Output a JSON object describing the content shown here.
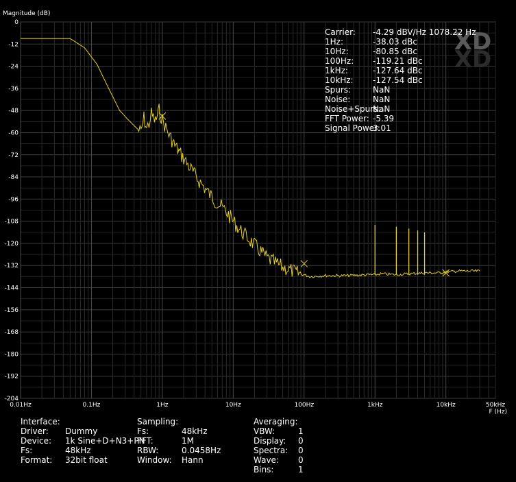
{
  "chart_data": {
    "type": "line",
    "ylabel": "Magnitude (dB)",
    "xlabel": "F (Hz)",
    "xscale": "log",
    "xlim": [
      0.01,
      50000
    ],
    "ylim": [
      -204,
      0
    ],
    "grid": true,
    "line_color": "#e6d21e",
    "xticks": [
      {
        "value": 0.01,
        "label": "0.01Hz"
      },
      {
        "value": 0.1,
        "label": "0.1Hz"
      },
      {
        "value": 1,
        "label": "1Hz"
      },
      {
        "value": 10,
        "label": "10Hz"
      },
      {
        "value": 100,
        "label": "100Hz"
      },
      {
        "value": 1000,
        "label": "1kHz"
      },
      {
        "value": 10000,
        "label": "10kHz"
      },
      {
        "value": 50000,
        "label": "50kHz"
      }
    ],
    "yticks": [
      0,
      -12,
      -24,
      -36,
      -48,
      -60,
      -72,
      -84,
      -96,
      -108,
      -120,
      -132,
      -144,
      -156,
      -168,
      -180,
      -192,
      -204
    ],
    "x": [
      0.01,
      0.05,
      0.08,
      0.12,
      0.18,
      0.25,
      0.33,
      0.42,
      0.5,
      0.55,
      0.6,
      0.65,
      0.7,
      0.8,
      0.9,
      1.0,
      1.2,
      1.5,
      2,
      3,
      5,
      8,
      12,
      20,
      30,
      50,
      80,
      120,
      200,
      400,
      800,
      1000,
      1200,
      2000,
      3000,
      5000,
      8000,
      10000,
      15000,
      20000,
      30000
    ],
    "y": [
      -9,
      -9,
      -14,
      -23,
      -37,
      -48,
      -53,
      -57,
      -60,
      -52,
      -58,
      -55,
      -50,
      -54,
      -48,
      -53,
      -60,
      -67,
      -74,
      -84,
      -95,
      -103,
      -112,
      -121,
      -128,
      -133,
      -136,
      -138,
      -137.5,
      -137.5,
      -137,
      -137,
      -136.5,
      -137,
      -136.5,
      -136,
      -136,
      -135.5,
      -135,
      -135,
      -135
    ],
    "spurs": [
      {
        "x": 1000,
        "y": -110
      },
      {
        "x": 2000,
        "y": -111
      },
      {
        "x": 3000,
        "y": -112
      },
      {
        "x": 4000,
        "y": -113
      },
      {
        "x": 5000,
        "y": -114
      }
    ],
    "markers": [
      {
        "x": 1,
        "y": -51
      },
      {
        "x": 100,
        "y": -131
      },
      {
        "x": 10000,
        "y": -136
      }
    ]
  },
  "readout": [
    {
      "label": "Carrier:",
      "value": "-4.29 dBV/Hz 1078.22 Hz"
    },
    {
      "label": "1Hz:",
      "value": "-38.03 dBc"
    },
    {
      "label": "10Hz:",
      "value": "-80.85 dBc"
    },
    {
      "label": "100Hz:",
      "value": "-119.21 dBc"
    },
    {
      "label": "1kHz:",
      "value": "-127.64 dBc"
    },
    {
      "label": "10kHz:",
      "value": "-127.54 dBc"
    },
    {
      "label": "Spurs:",
      "value": "NaN"
    },
    {
      "label": "Noise:",
      "value": "NaN"
    },
    {
      "label": "Noise+Spurs:",
      "value": "NaN"
    },
    {
      "label": "FFT Power:",
      "value": "-5.39"
    },
    {
      "label": "Signal Power:",
      "value": "3.01"
    }
  ],
  "logo": "XD",
  "interface": {
    "heading": "Interface:",
    "rows": [
      {
        "label": "Driver:",
        "value": "Dummy"
      },
      {
        "label": "Device:",
        "value": "1k Sine+D+N3+PN"
      },
      {
        "label": "Fs:",
        "value": "48kHz"
      },
      {
        "label": "Format:",
        "value": "32bit float"
      }
    ]
  },
  "sampling": {
    "heading": "Sampling:",
    "rows": [
      {
        "label": "Fs:",
        "value": "48kHz"
      },
      {
        "label": "FFT:",
        "value": "1M"
      },
      {
        "label": "RBW:",
        "value": "0.0458Hz"
      },
      {
        "label": "Window:",
        "value": "Hann"
      }
    ]
  },
  "averaging": {
    "heading": "Averaging:",
    "rows": [
      {
        "label": "VBW:",
        "value": "1"
      },
      {
        "label": "Display:",
        "value": "0"
      },
      {
        "label": "Spectra:",
        "value": "0"
      },
      {
        "label": "Wave:",
        "value": "0"
      },
      {
        "label": "Bins:",
        "value": "1"
      }
    ]
  }
}
